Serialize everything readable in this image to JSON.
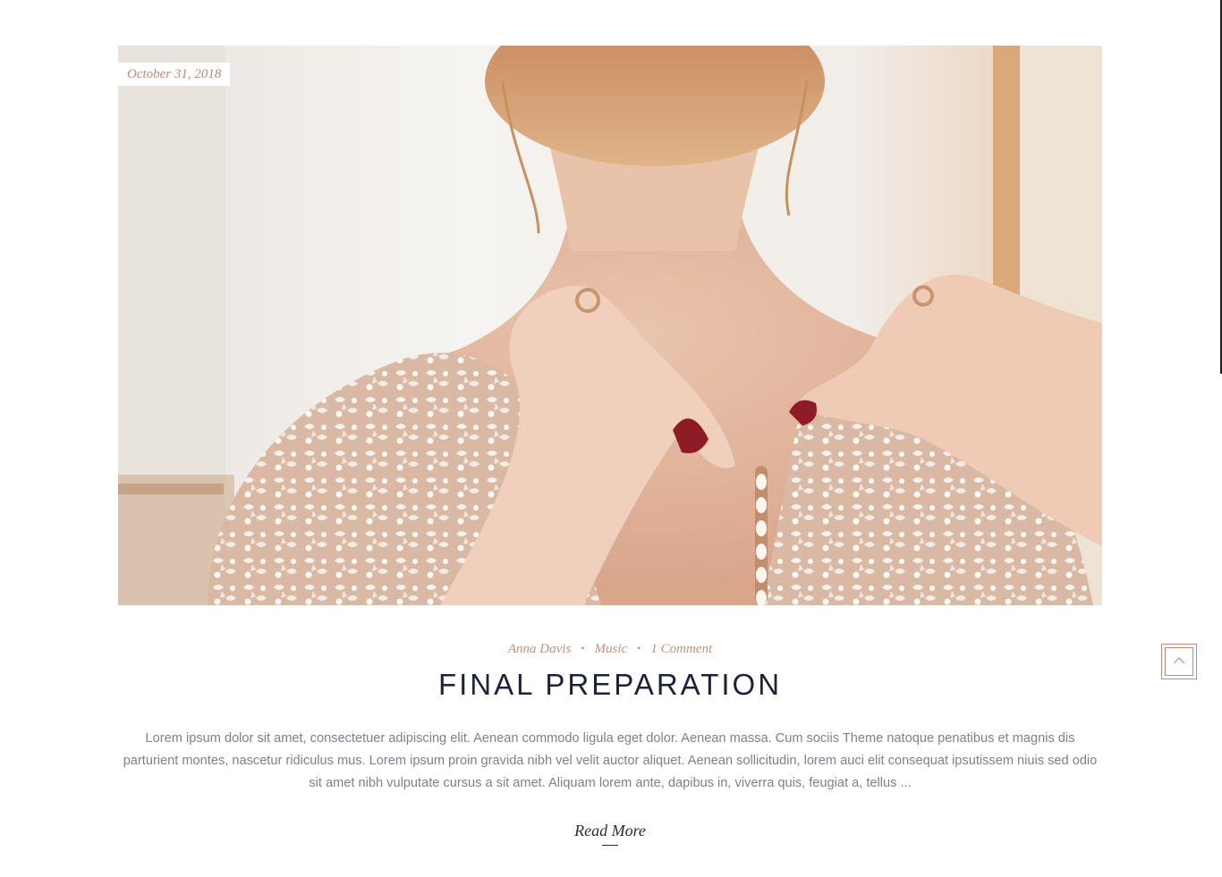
{
  "post": {
    "date": "October 31, 2018",
    "author": "Anna Davis",
    "category": "Music",
    "comments": "1 Comment",
    "title": "FINAL PREPARATION",
    "excerpt": "Lorem ipsum dolor sit amet, consectetuer adipiscing elit. Aenean commodo ligula eget dolor. Aenean massa. Cum sociis Theme natoque penatibus et magnis dis parturient montes, nascetur ridiculus mus. Lorem ipsum proin gravida nibh vel velit auctor aliquet. Aenean sollicitudin, lorem auci elit consequat ipsutissem niuis sed odio sit amet nibh vulputate cursus a sit amet. Aliquam lorem ante, dapibus in, viverra quis, feugiat a, tellus ...",
    "read_more": "Read More",
    "meta_separator": "•"
  },
  "back_to_top": {
    "icon": "chevron-up-icon"
  },
  "colors": {
    "accent": "#c0907f",
    "title": "#1c2237",
    "body_text": "#7d8091"
  }
}
